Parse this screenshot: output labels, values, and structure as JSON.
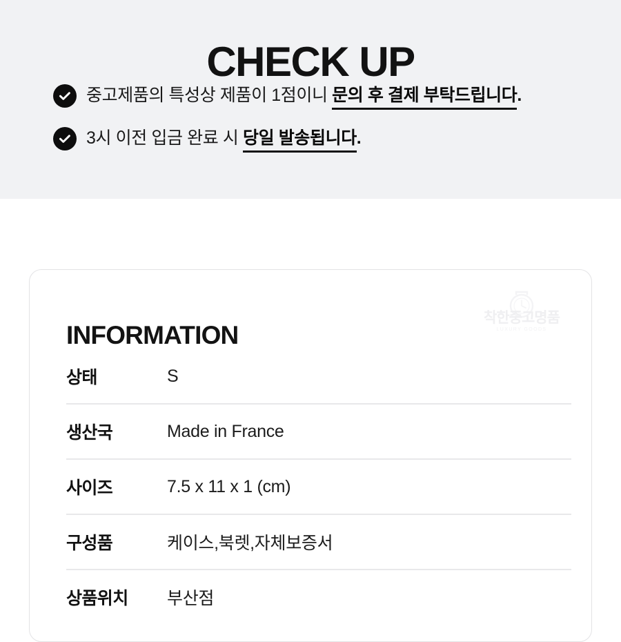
{
  "checkup": {
    "title": "CHECK UP",
    "bullets": [
      {
        "icon": "check-circle-icon",
        "normal": "중고제품의 특성상 제품이 1점이니 ",
        "emphasis": "문의 후 결제 부탁드립니다",
        "tail": "."
      },
      {
        "icon": "check-circle-icon",
        "normal": "3시 이전 입금 완료 시 ",
        "emphasis": "당일 발송됩니다",
        "tail": "."
      }
    ]
  },
  "information": {
    "title": "INFORMATION",
    "watermark": {
      "icon": "watch-logo-icon",
      "brand": "착한중고명품",
      "subtitle": "LUXURY GOODS"
    },
    "rows": [
      {
        "label": "상태",
        "value": "S"
      },
      {
        "label": "생산국",
        "value": "Made in France"
      },
      {
        "label": "사이즈",
        "value": "7.5 x 11 x 1 (cm)"
      },
      {
        "label": "구성품",
        "value": "케이스,북렛,자체보증서"
      },
      {
        "label": "상품위치",
        "value": "부산점"
      }
    ]
  },
  "colors": {
    "banner_background": "#f1f2f4",
    "page_background": "#ffffff",
    "text": "#111111",
    "icon_fill": "#0d0d0d",
    "card_border": "#e3e3e5",
    "divider": "#e8e8ea",
    "watermark": "#efeff1"
  }
}
